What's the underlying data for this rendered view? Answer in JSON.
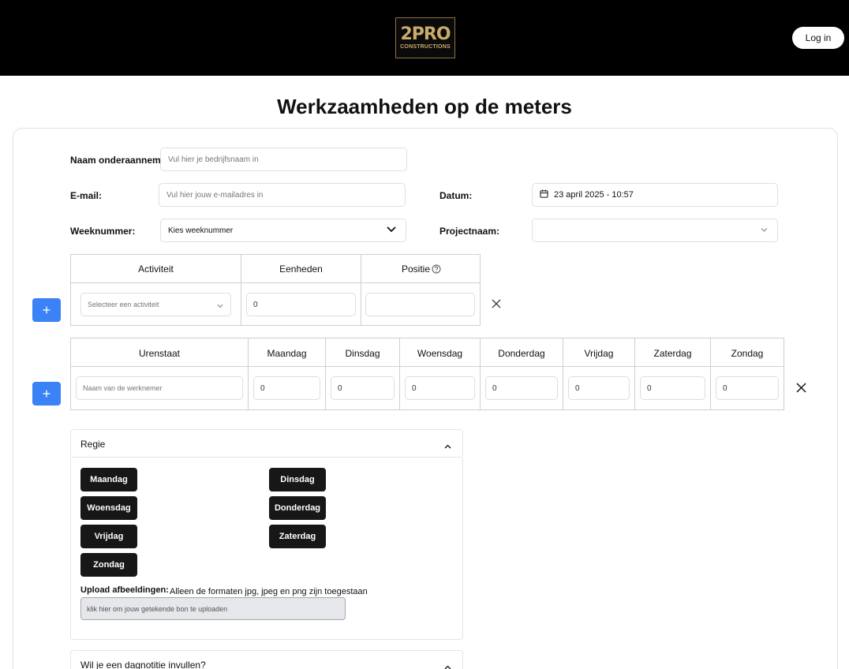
{
  "header": {
    "logo_main": "2PRO",
    "logo_sub": "CONSTRUCTIONS",
    "login_label": "Log in"
  },
  "page": {
    "title": "Werkzaamheden op de meters"
  },
  "form": {
    "subcontractor_label": "Naam onderaannemer:",
    "subcontractor_placeholder": "Vul hier je bedrijfsnaam in",
    "email_label": "E-mail:",
    "email_placeholder": "Vul hier jouw e-mailadres in",
    "date_label": "Datum:",
    "date_value": "23 april 2025 - 10:57",
    "week_label": "Weeknummer:",
    "week_value": "Kies weeknummer",
    "project_label": "Projectnaam:",
    "project_value": ""
  },
  "activity_table": {
    "headers": [
      "Activiteit",
      "Eenheden",
      "Positie"
    ],
    "activity_placeholder": "Selecteer een activiteit",
    "units_value": "0",
    "position_value": ""
  },
  "hours_table": {
    "headers": [
      "Urenstaat",
      "Maandag",
      "Dinsdag",
      "Woensdag",
      "Donderdag",
      "Vrijdag",
      "Zaterdag",
      "Zondag"
    ],
    "employee_placeholder": "Naam van de werknemer",
    "day_values": [
      "0",
      "0",
      "0",
      "0",
      "0",
      "0",
      "0"
    ]
  },
  "regie": {
    "title": "Regie",
    "days": [
      "Maandag",
      "Dinsdag",
      "Woensdag",
      "Donderdag",
      "Vrijdag",
      "Zaterdag",
      "Zondag"
    ],
    "upload_label": "Upload afbeeldingen:",
    "upload_note": "Alleen de formaten jpg, jpeg en png zijn toegestaan",
    "upload_placeholder": "klik hier om jouw getekende bon te uploaden"
  },
  "dagnotitie": {
    "title": "Wil je een dagnotitie invullen?"
  },
  "colors": {
    "header_bg": "#000000",
    "accent_blue": "#3b82f6",
    "dark_button": "#171717",
    "logo_gold": "#c9ab6b"
  }
}
